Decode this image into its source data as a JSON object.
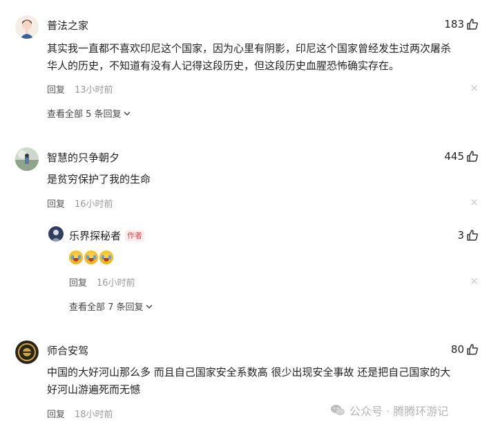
{
  "comments": [
    {
      "user": "普法之家",
      "likes": "183",
      "text_line1": "其实我一直都不喜欢印尼这个国家，因为心里有阴影，印尼这个国家曾经发生过两次屠杀",
      "text_line2": "华人的历史，不知道有没有人记得这段历史，但这段历史血腥恐怖确实存在。",
      "reply_label": "回复",
      "time": "13小时前",
      "view_replies": "查看全部 5 条回复"
    },
    {
      "user": "智慧的只争朝夕",
      "likes": "445",
      "text_line1": "是贫穷保护了我的生命",
      "reply_label": "回复",
      "time": "16小时前",
      "reply": {
        "user": "乐界探秘者",
        "badge": "作者",
        "likes": "3",
        "reply_label": "回复",
        "time": "16小时前"
      },
      "view_replies": "查看全部 7 条回复"
    },
    {
      "user": "师合安驾",
      "likes": "80",
      "text_line1": "中国的大好河山那么多 而且自己国家安全系数高 很少出现安全事故 还是把自己国家的大",
      "text_line2": "好河山游遍死而无憾",
      "reply_label": "回复",
      "time": "18小时前"
    }
  ],
  "close_glyph": "×",
  "watermark": "公众号 · 腾腾环游记",
  "icons": {
    "like": "thumbs-up-icon",
    "close": "close-icon",
    "expand": "chevron-down-icon",
    "wechat": "wechat-icon"
  }
}
